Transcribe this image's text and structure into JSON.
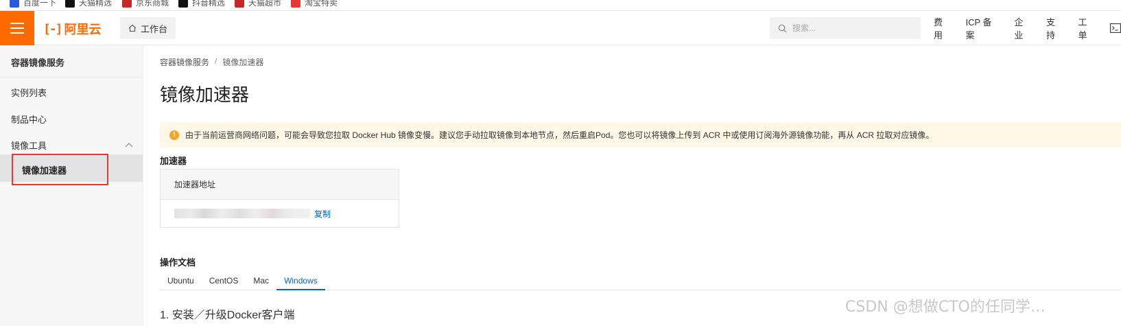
{
  "bookmarks": [
    {
      "label": "百度一下",
      "color": "#2b57d9"
    },
    {
      "label": "天猫精选",
      "color": "#111111"
    },
    {
      "label": "京东商城",
      "color": "#c62828"
    },
    {
      "label": "抖音精选",
      "color": "#111111"
    },
    {
      "label": "天猫超市",
      "color": "#c62828"
    },
    {
      "label": "淘宝特卖",
      "color": "#e53935"
    }
  ],
  "topbar": {
    "logo_text": "阿里云",
    "workbench_label": "工作台",
    "search_placeholder": "搜索...",
    "nav": [
      "费用",
      "ICP 备案",
      "企业",
      "支持",
      "工单"
    ],
    "accent_color": "#ff6a00"
  },
  "sidebar": {
    "title": "容器镜像服务",
    "items": [
      "实例列表",
      "制品中心"
    ],
    "group_label": "镜像工具",
    "active_item": "镜像加速器"
  },
  "main": {
    "breadcrumb": [
      "容器镜像服务",
      "镜像加速器"
    ],
    "breadcrumb_sep": "/",
    "page_title": "镜像加速器",
    "alert_text": "由于当前运营商网络问题，可能会导致您拉取 Docker Hub 镜像变慢。建议您手动拉取镜像到本地节点，然后重启Pod。您也可以将镜像上传到 ACR 中或使用订阅海外源镜像功能，再从 ACR 拉取对应镜像。",
    "accelerator_section": "加速器",
    "accelerator_table_header": "加速器地址",
    "copy_label": "复制",
    "docs_section": "操作文档",
    "tabs": [
      "Ubuntu",
      "CentOS",
      "Mac",
      "Windows"
    ],
    "active_tab": "Windows",
    "step_text": "1. 安装／升级Docker客户端"
  },
  "watermark": "CSDN @想做CTO的任同学…"
}
